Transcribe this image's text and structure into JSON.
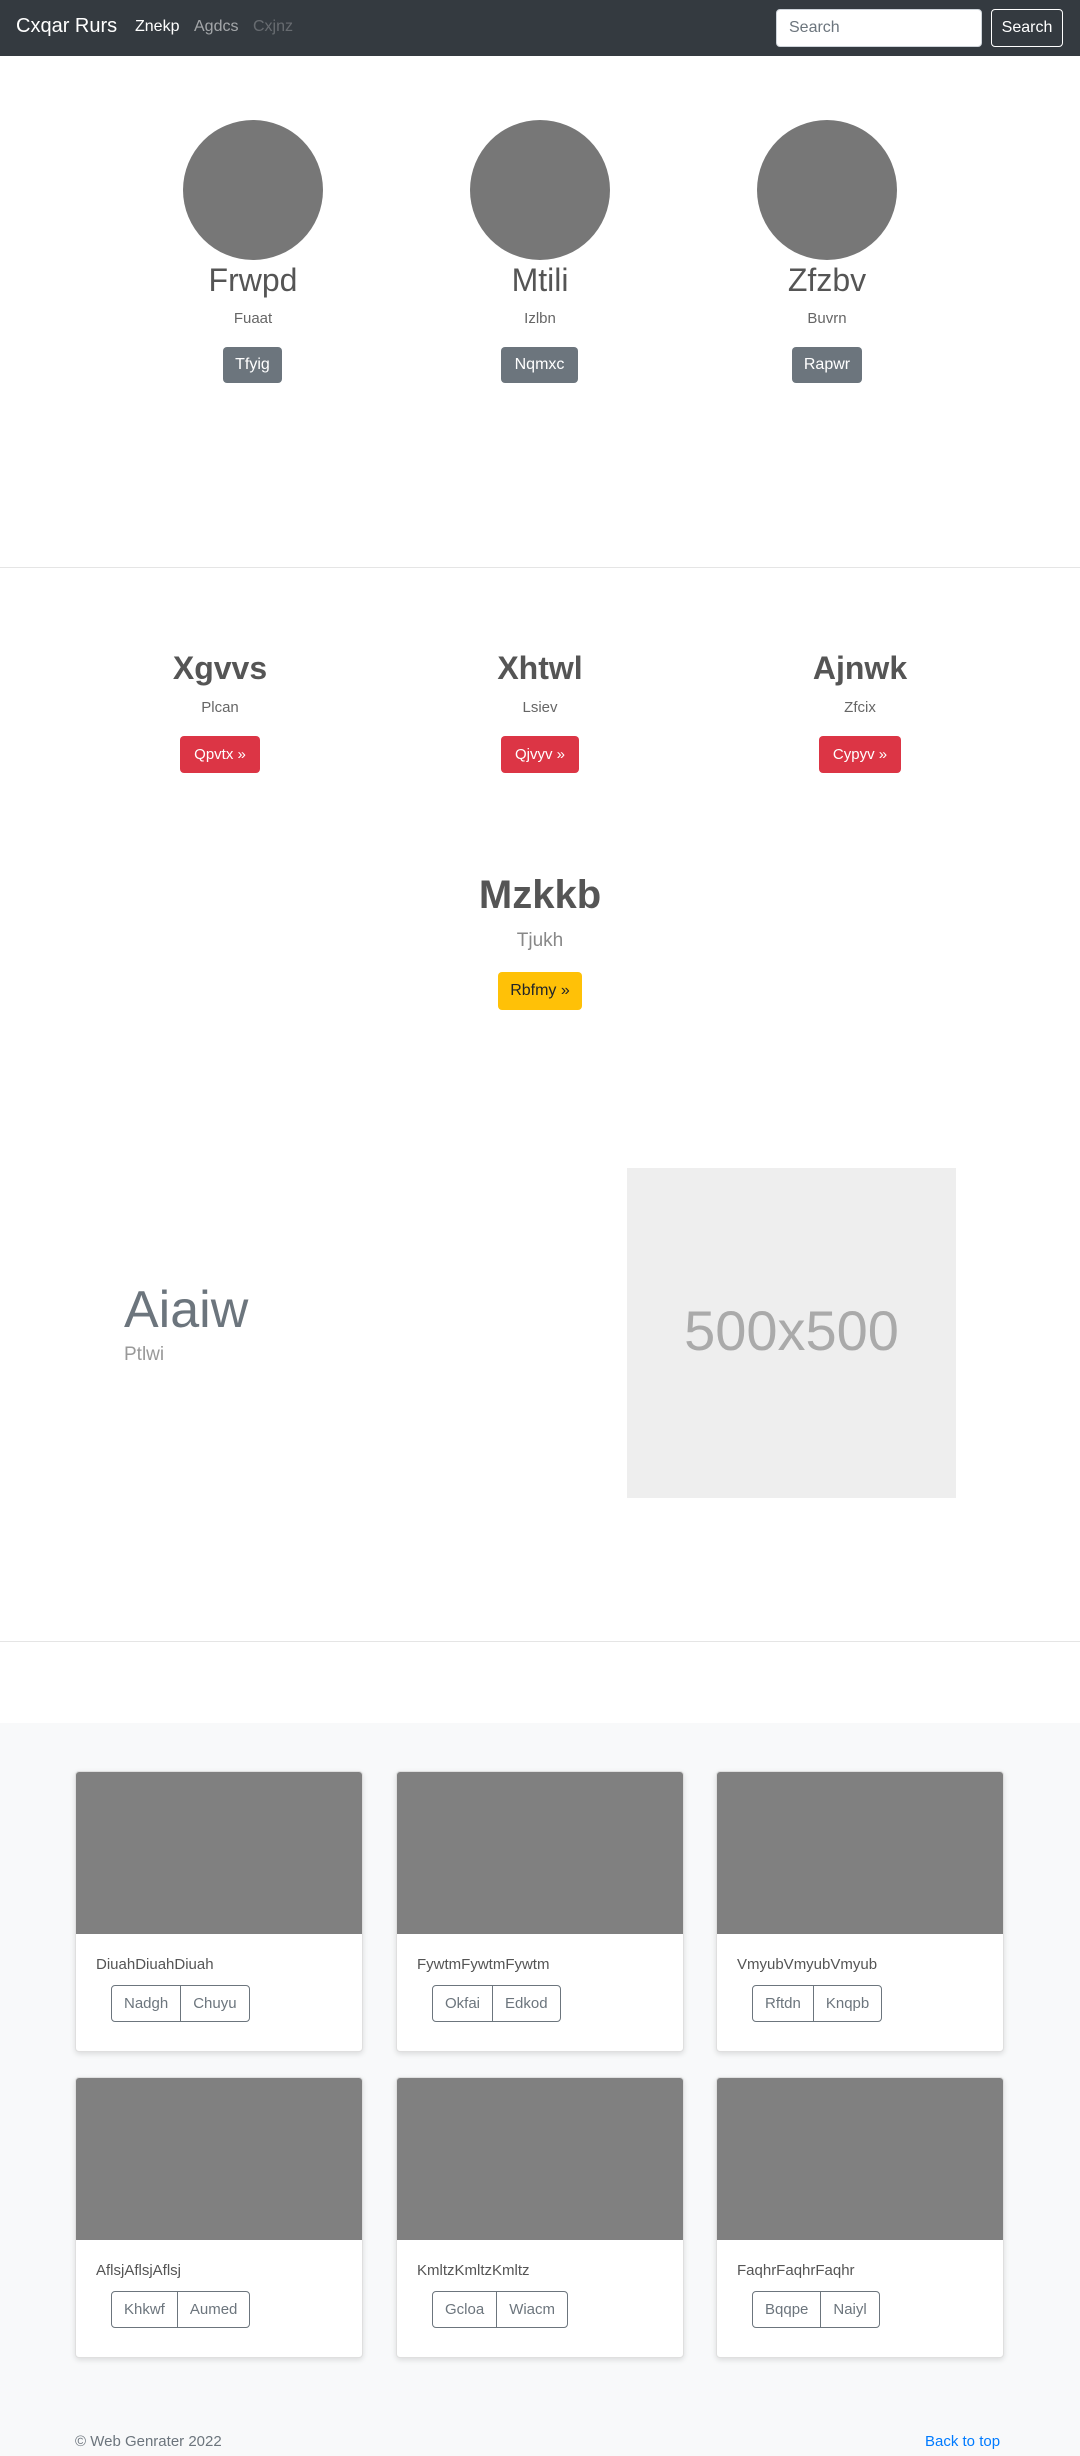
{
  "navbar": {
    "brand": "Cxqar Rurs",
    "links": [
      "Znekp",
      "Agdcs",
      "Cxjnz"
    ],
    "search_placeholder": "Search",
    "search_button": "Search"
  },
  "people": [
    {
      "name": "Frwpd",
      "sub": "Fuaat",
      "button": "Tfyig"
    },
    {
      "name": "Mtili",
      "sub": "Izlbn",
      "button": "Nqmxc"
    },
    {
      "name": "Zfzbv",
      "sub": "Buvrn",
      "button": "Rapwr"
    }
  ],
  "features": [
    {
      "title": "Xgvvs",
      "sub": "Plcan",
      "button": "Qpvtx »"
    },
    {
      "title": "Xhtwl",
      "sub": "Lsiev",
      "button": "Qjvyv »"
    },
    {
      "title": "Ajnwk",
      "sub": "Zfcix",
      "button": "Cypyv »"
    }
  ],
  "main_feature": {
    "title": "Mzkkb",
    "sub": "Tjukh",
    "button": "Rbfmy »"
  },
  "hero": {
    "title": "Aiaiw",
    "sub": "Ptlwi",
    "image_label": "500x500"
  },
  "cards": [
    {
      "text": "DiuahDiuahDiuah",
      "buttons": [
        "Nadgh",
        "Chuyu"
      ]
    },
    {
      "text": "FywtmFywtmFywtm",
      "buttons": [
        "Okfai",
        "Edkod"
      ]
    },
    {
      "text": "VmyubVmyubVmyub",
      "buttons": [
        "Rftdn",
        "Knqpb"
      ]
    },
    {
      "text": "AflsjAflsjAflsj",
      "buttons": [
        "Khkwf",
        "Aumed"
      ]
    },
    {
      "text": "KmltzKmltzKmltz",
      "buttons": [
        "Gcloa",
        "Wiacm"
      ]
    },
    {
      "text": "FaqhrFaqhrFaqhr",
      "buttons": [
        "Bqqpe",
        "Naiyl"
      ]
    }
  ],
  "footer": {
    "copyright": "© Web Genrater 2022",
    "back_to_top": "Back to top"
  },
  "colors": {
    "navbar": "#343a40",
    "danger": "#dc3545",
    "warning": "#ffc107",
    "secondary": "#6c757d",
    "link": "#007bff"
  }
}
